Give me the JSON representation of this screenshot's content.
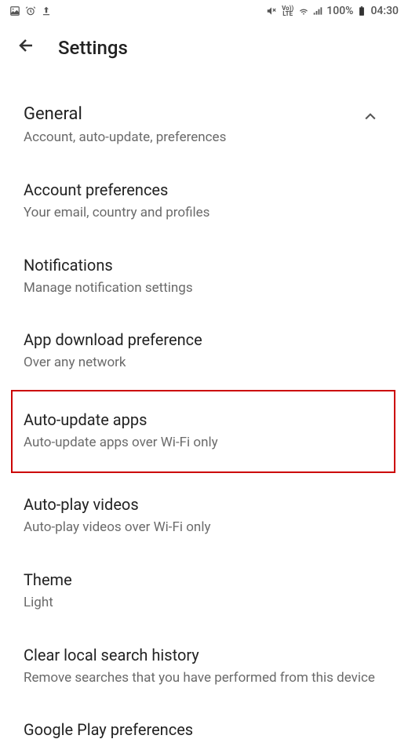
{
  "status_bar": {
    "battery_pct": "100%",
    "time": "04:30",
    "volte_line1": "Vo))",
    "volte_line2": "LTE"
  },
  "header": {
    "title": "Settings"
  },
  "section": {
    "title": "General",
    "subtitle": "Account, auto-update, preferences"
  },
  "items": [
    {
      "title": "Account preferences",
      "subtitle": "Your email, country and profiles"
    },
    {
      "title": "Notifications",
      "subtitle": "Manage notification settings"
    },
    {
      "title": "App download preference",
      "subtitle": "Over any network"
    },
    {
      "title": "Auto-update apps",
      "subtitle": "Auto-update apps over Wi-Fi only"
    },
    {
      "title": "Auto-play videos",
      "subtitle": "Auto-play videos over Wi-Fi only"
    },
    {
      "title": "Theme",
      "subtitle": "Light"
    },
    {
      "title": "Clear local search history",
      "subtitle": "Remove searches that you have performed from this device"
    },
    {
      "title": "Google Play preferences",
      "subtitle": ""
    }
  ]
}
